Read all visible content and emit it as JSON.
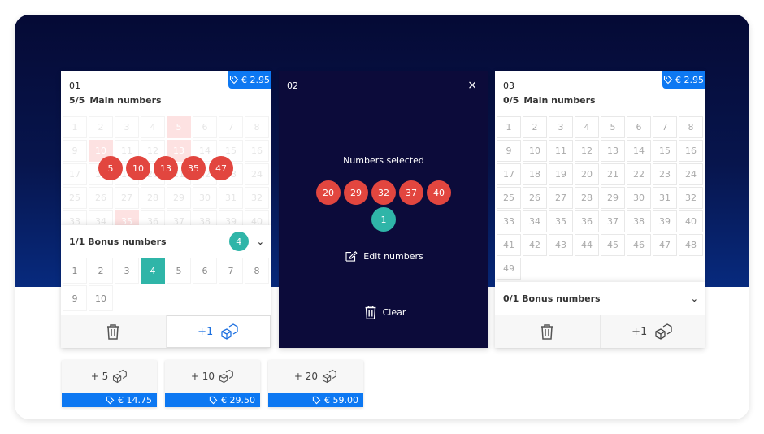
{
  "currency": "€",
  "colors": {
    "primary": "#0d78f2",
    "main_ball": "#e2463f",
    "bonus_ball": "#2fb5a8",
    "hero_dark": "#050a35"
  },
  "panels": [
    {
      "index": "01",
      "price": "€ 2.95",
      "main_count": "5/5",
      "main_label": "Main numbers",
      "main_numbers": [
        "1",
        "2",
        "3",
        "4",
        "5",
        "6",
        "7",
        "8",
        "9",
        "10",
        "11",
        "12",
        "13",
        "14",
        "15",
        "16",
        "17",
        "18",
        "19",
        "20",
        "21",
        "22",
        "23",
        "24",
        "25",
        "26",
        "27",
        "28",
        "29",
        "30",
        "31",
        "32",
        "33",
        "34",
        "35",
        "36",
        "37",
        "38",
        "39",
        "40"
      ],
      "selected_main": [
        "5",
        "10",
        "13",
        "35",
        "47"
      ],
      "bonus_label": "1/1 Bonus numbers",
      "bonus_badge": "4",
      "bonus_numbers": [
        "1",
        "2",
        "3",
        "4",
        "5",
        "6",
        "7",
        "8",
        "9",
        "10"
      ],
      "selected_bonus": "4",
      "quick_pick_label": "+1"
    },
    {
      "index": "02",
      "overlay_title": "Numbers selected",
      "selected_main": [
        "20",
        "29",
        "32",
        "37",
        "40"
      ],
      "selected_bonus": "1",
      "edit_label": "Edit numbers",
      "clear_label": "Clear",
      "close_label": "×"
    },
    {
      "index": "03",
      "price": "€ 2.95",
      "main_count": "0/5",
      "main_label": "Main numbers",
      "main_numbers": [
        "1",
        "2",
        "3",
        "4",
        "5",
        "6",
        "7",
        "8",
        "9",
        "10",
        "11",
        "12",
        "13",
        "14",
        "15",
        "16",
        "17",
        "18",
        "19",
        "20",
        "21",
        "22",
        "23",
        "24",
        "25",
        "26",
        "27",
        "28",
        "29",
        "30",
        "31",
        "32",
        "33",
        "34",
        "35",
        "36",
        "37",
        "38",
        "39",
        "40",
        "41",
        "42",
        "43",
        "44",
        "45",
        "46",
        "47",
        "48",
        "49"
      ],
      "bonus_label": "0/1 Bonus numbers",
      "quick_pick_label": "+1"
    }
  ],
  "bulk_options": [
    {
      "label": "+ 5",
      "price": "€ 14.75"
    },
    {
      "label": "+ 10",
      "price": "€ 29.50"
    },
    {
      "label": "+ 20",
      "price": "€ 59.00"
    }
  ]
}
